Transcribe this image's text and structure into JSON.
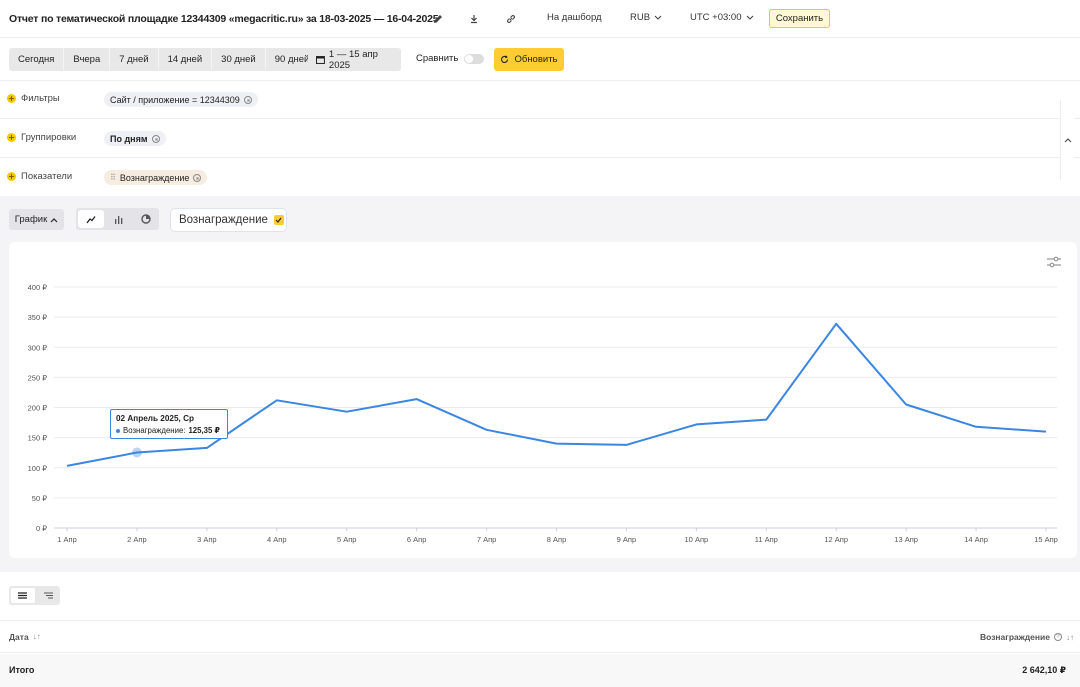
{
  "header": {
    "title": "Отчет по тематической площадке 12344309 «megacritic.ru» за 18-03-2025 — 16-04-2025",
    "edit_icon": "pencil-icon",
    "download_icon": "download-icon",
    "link_icon": "link-icon",
    "dashboard_label": "На дашборд",
    "currency": "RUB",
    "timezone": "UTC +03:00",
    "save_label": "Сохранить"
  },
  "period": {
    "buttons": [
      "Сегодня",
      "Вчера",
      "7 дней",
      "14 дней",
      "30 дней",
      "90 дней"
    ],
    "date_range": "1 — 15 апр 2025",
    "compare_label": "Сравнить",
    "refresh_label": "Обновить"
  },
  "settings": {
    "filters_label": "Фильтры",
    "filter_chip": "Сайт / приложение = 12344309",
    "groupings_label": "Группировки",
    "grouping_chip": "По дням",
    "metrics_label": "Показатели",
    "metric_chip": "Вознаграждение"
  },
  "chart_controls": {
    "type_label": "График",
    "metric_label": "Вознаграждение"
  },
  "tooltip": {
    "title": "02 Апрель 2025, Ср",
    "series": "Вознаграждение:",
    "value": "125,35 ₽"
  },
  "chart_data": {
    "type": "line",
    "categories": [
      "1 Апр",
      "2 Апр",
      "3 Апр",
      "4 Апр",
      "5 Апр",
      "6 Апр",
      "7 Апр",
      "8 Апр",
      "9 Апр",
      "10 Апр",
      "11 Апр",
      "12 Апр",
      "13 Апр",
      "14 Апр",
      "15 Апр"
    ],
    "series": [
      {
        "values": [
          103,
          125.35,
          133,
          212,
          193,
          214,
          163,
          140,
          138,
          172,
          180,
          339,
          205,
          168,
          160
        ],
        "color": "#3a86e0"
      }
    ],
    "y_ticks": [
      "0 ₽",
      "50 ₽",
      "100 ₽",
      "150 ₽",
      "200 ₽",
      "250 ₽",
      "300 ₽",
      "350 ₽",
      "400 ₽"
    ],
    "ylim": [
      0,
      400
    ],
    "grid": true
  },
  "table": {
    "date_header": "Дата",
    "reward_header": "Вознаграждение",
    "total_label": "Итого",
    "total_value": "2 642,10 ₽"
  }
}
